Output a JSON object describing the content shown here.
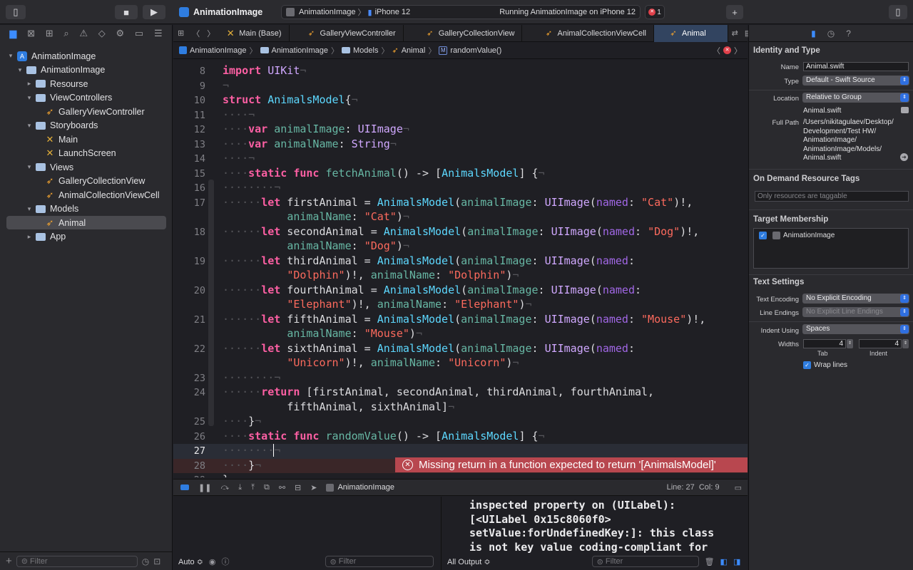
{
  "toolbar": {
    "project": "AnimationImage",
    "scheme": "AnimationImage",
    "destination": "iPhone 12",
    "status": "Running AnimationImage on iPhone 12",
    "error_count": "1"
  },
  "navigator": {
    "tree": [
      {
        "label": "AnimationImage",
        "kind": "project",
        "expanded": true
      },
      {
        "label": "AnimationImage",
        "kind": "folder",
        "expanded": true
      },
      {
        "label": "Resourse",
        "kind": "folder",
        "expanded": false
      },
      {
        "label": "ViewControllers",
        "kind": "folder",
        "expanded": true
      },
      {
        "label": "GalleryViewController",
        "kind": "swift"
      },
      {
        "label": "Storyboards",
        "kind": "folder",
        "expanded": true
      },
      {
        "label": "Main",
        "kind": "storyboard"
      },
      {
        "label": "LaunchScreen",
        "kind": "storyboard"
      },
      {
        "label": "Views",
        "kind": "folder",
        "expanded": true
      },
      {
        "label": "GalleryCollectionView",
        "kind": "swift"
      },
      {
        "label": "AnimalCollectionViewCell",
        "kind": "swift"
      },
      {
        "label": "Models",
        "kind": "folder",
        "expanded": true
      },
      {
        "label": "Animal",
        "kind": "swift",
        "selected": true
      },
      {
        "label": "App",
        "kind": "folder",
        "expanded": false
      }
    ],
    "filter_placeholder": "Filter"
  },
  "tabs": [
    {
      "label": "Main (Base)"
    },
    {
      "label": "GalleryViewController"
    },
    {
      "label": "GalleryCollectionView"
    },
    {
      "label": "AnimalCollectionViewCell"
    },
    {
      "label": "Animal",
      "active": true
    }
  ],
  "breadcrumb": [
    "AnimationImage",
    "AnimationImage",
    "Models",
    "Animal",
    "randomValue()"
  ],
  "editor": {
    "cursor_line": 27,
    "error_line": 28,
    "error_message": "Missing return in a function expected to return '[AnimalsModel]'"
  },
  "debug": {
    "target": "AnimationImage",
    "position": "Line: 27  Col: 9",
    "auto_label": "Auto ≎",
    "filter_placeholder": "Filter",
    "output_label": "All Output ≎"
  },
  "console": {
    "text": "inspected property on (UILabel):\n[<UILabel 0x15c8060f0>\nsetValue:forUndefinedKey:]: this class\nis not key value coding-compliant for"
  },
  "inspector": {
    "identity_title": "Identity and Type",
    "name_label": "Name",
    "name": "Animal.swift",
    "type_label": "Type",
    "type": "Default - Swift Source",
    "location_label": "Location",
    "location": "Relative to Group",
    "location_file": "Animal.swift",
    "fullpath_label": "Full Path",
    "fullpath": [
      "/Users/nikitagulaev/Desktop/",
      "Development/Test HW/",
      "AnimationImage/",
      "AnimationImage/Models/",
      "Animal.swift"
    ],
    "odr_title": "On Demand Resource Tags",
    "odr_placeholder": "Only resources are taggable",
    "target_title": "Target Membership",
    "target": "AnimationImage",
    "text_title": "Text Settings",
    "encoding_label": "Text Encoding",
    "encoding": "No Explicit Encoding",
    "endings_label": "Line Endings",
    "endings": "No Explicit Line Endings",
    "indent_label": "Indent Using",
    "indent": "Spaces",
    "widths_label": "Widths",
    "tab_width": "4",
    "indent_width": "4",
    "tab_label": "Tab",
    "indent_sub": "Indent",
    "wrap": "Wrap lines"
  }
}
